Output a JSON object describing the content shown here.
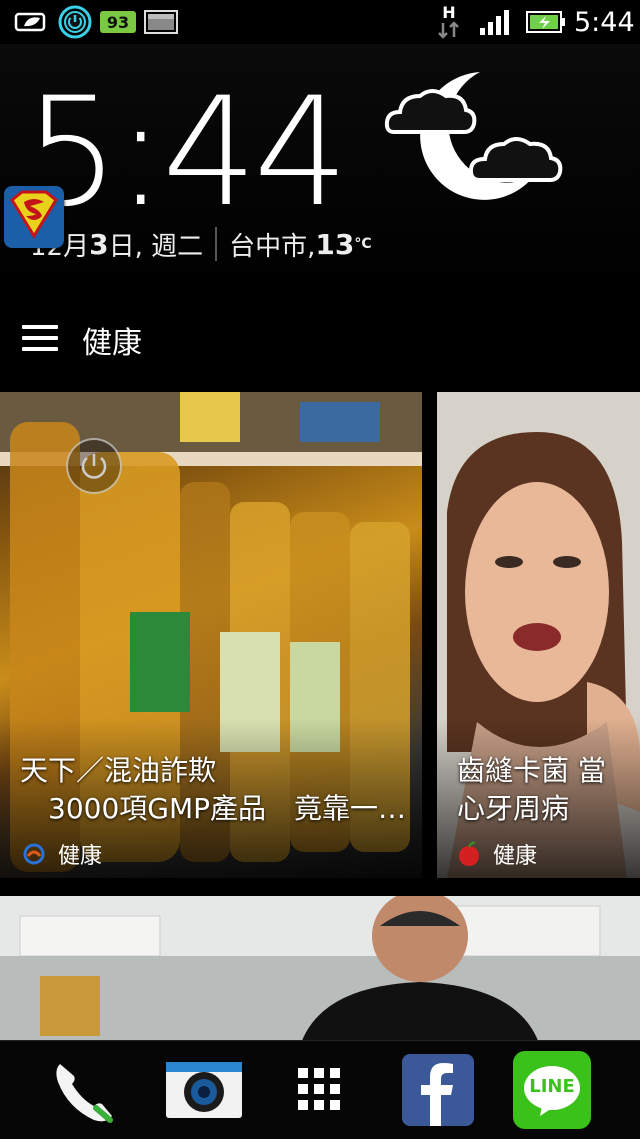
{
  "status_bar": {
    "battery_badge": "93",
    "network_type": "H",
    "time": "5:44",
    "icons": [
      "leaf-battery-icon",
      "power-save-icon",
      "battery-badge-icon",
      "screenshot-icon",
      "network-h-icon",
      "signal-icon",
      "battery-icon"
    ]
  },
  "clock_widget": {
    "time": "5:44",
    "date_prefix": "12月 ",
    "date_day": "3",
    "date_suffix": " 日, 週二",
    "city": "台中市, ",
    "temperature": "13",
    "unit": "°C",
    "weather_icon": "moon-cloud-icon"
  },
  "feed": {
    "title": "健康",
    "cards": [
      {
        "title": "天下／混油詐欺 3000項GMP產品　竟靠一…",
        "title_line1": "天下／混油詐欺",
        "title_line2": "3000項GMP產品　竟靠一…",
        "source": "健康"
      },
      {
        "title_line1": "齒縫卡菌 當",
        "title_line2": "心牙周病",
        "source": "健康"
      }
    ]
  },
  "dock": {
    "items": [
      "phone-icon",
      "camera-icon",
      "app-drawer-icon",
      "facebook-icon",
      "line-icon"
    ],
    "line_label": "LINE"
  },
  "colors": {
    "facebook": "#3b5998",
    "line": "#3ac21b",
    "status_green": "#6fd14a"
  }
}
